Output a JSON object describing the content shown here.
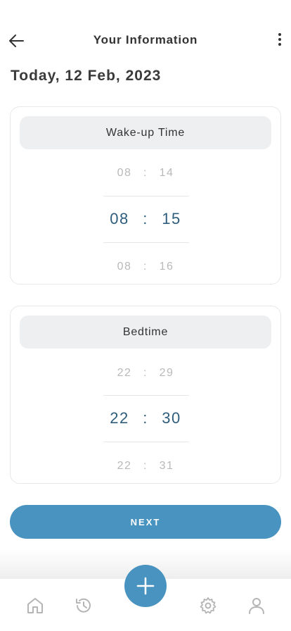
{
  "header": {
    "title": "Your Information"
  },
  "date_label": "Today, 12 Feb, 2023",
  "wake": {
    "title": "Wake-up Time",
    "prev": {
      "hour": "08",
      "sep": ":",
      "minute": "14"
    },
    "selected": {
      "hour": "08",
      "sep": ":",
      "minute": "15"
    },
    "next": {
      "hour": "08",
      "sep": ":",
      "minute": "16"
    }
  },
  "bed": {
    "title": "Bedtime",
    "prev": {
      "hour": "22",
      "sep": ":",
      "minute": "29"
    },
    "selected": {
      "hour": "22",
      "sep": ":",
      "minute": "30"
    },
    "next": {
      "hour": "22",
      "sep": ":",
      "minute": "31"
    }
  },
  "next_button": {
    "label": "NEXT"
  },
  "colors": {
    "accent": "#4893c0",
    "selected_time": "#2f5d7c",
    "faded_time": "#b9b9b9",
    "card_header_bg": "#eeeff1"
  },
  "bottom_nav": {
    "items": [
      "home-icon",
      "history-icon",
      "add-icon",
      "settings-icon",
      "profile-icon"
    ]
  }
}
